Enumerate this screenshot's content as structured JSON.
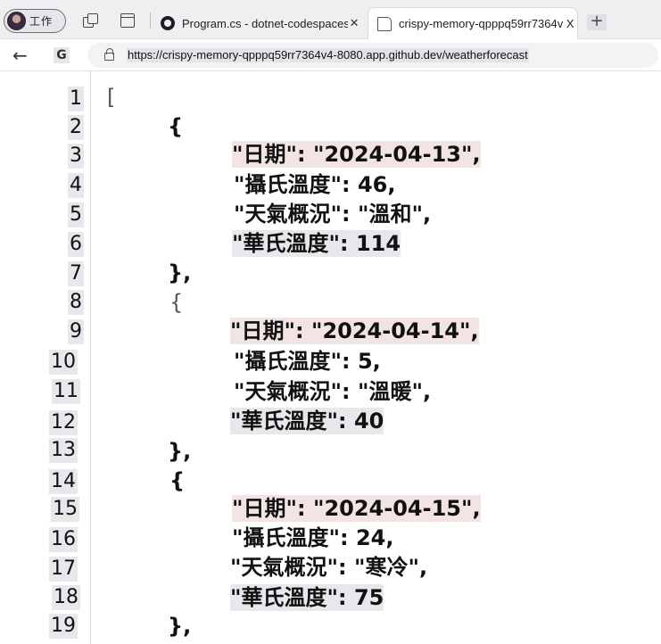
{
  "profile": {
    "label": "工作"
  },
  "tabs": [
    {
      "title": "Program.cs - dotnet-codespaces",
      "close": "✕"
    },
    {
      "title": "crispy-memory-qpppq59rr7364v X",
      "close": ""
    }
  ],
  "new_tab": "+",
  "address": {
    "url": "https://crispy-memory-qpppq59rr7364v4-8080.app.github.dev/weatherforecast"
  },
  "json_view": {
    "line_numbers": [
      "1",
      "2",
      "3",
      "4",
      "5",
      "6",
      "7",
      "8",
      "9",
      "10",
      "11",
      "12",
      "13",
      "14",
      "15",
      "16",
      "17",
      "18",
      "19"
    ],
    "lines": [
      "[",
      "{",
      "\"日期\": \"2024-04-13\",",
      "\"攝氏溫度\": 46,",
      "\"天氣概況\": \"溫和\",",
      "\"華氏溫度\": 114",
      "},",
      "{",
      "\"日期\": \"2024-04-14\",",
      "\"攝氏溫度\": 5,",
      "\"天氣概況\": \"溫暖\",",
      "\"華氏溫度\": 40",
      "},",
      "{",
      "\"日期\": \"2024-04-15\",",
      "\"攝氏溫度\": 24,",
      "\"天氣概況\": \"寒冷\",",
      "\"華氏溫度\": 75",
      "},"
    ]
  }
}
